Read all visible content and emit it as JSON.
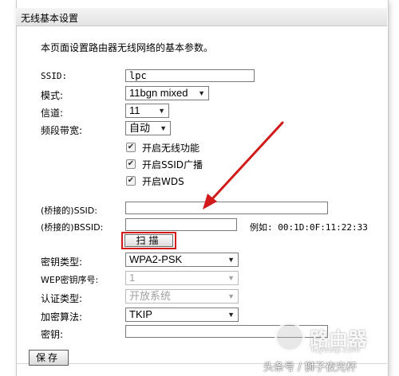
{
  "panel": {
    "title": "无线基本设置",
    "description": "本页面设置路由器无线网络的基本参数。"
  },
  "form": {
    "ssid_label": "SSID:",
    "ssid_value": "lpc",
    "mode_label": "模式:",
    "mode_value": "11bgn mixed",
    "channel_label": "信道:",
    "channel_value": "11",
    "bandwidth_label": "频段带宽:",
    "bandwidth_value": "自动",
    "checkboxes": [
      {
        "label": "开启无线功能",
        "checked": true
      },
      {
        "label": "开启SSID广播",
        "checked": true
      },
      {
        "label": "开启WDS",
        "checked": true
      }
    ],
    "bridge_ssid_label": "(桥接的)SSID:",
    "bridge_ssid_value": "",
    "bridge_bssid_label": "(桥接的)BSSID:",
    "bridge_bssid_value": "",
    "example_label": "例如: 00:1D:0F:11:22:33",
    "scan_label": "扫描",
    "key_type_label": "密钥类型:",
    "key_type_value": "WPA2-PSK",
    "wep_index_label": "WEP密钥序号:",
    "wep_index_value": "1",
    "auth_type_label": "认证类型:",
    "auth_type_value": "开放系统",
    "encryption_label": "加密算法:",
    "encryption_value": "TKIP",
    "key_label": "密钥:",
    "key_value": "",
    "save_label": "保存"
  },
  "annotation": {
    "arrow_color": "#d21a1a",
    "highlight_color": "#d21a1a"
  },
  "watermark": {
    "brand": "路由器",
    "url": "luyouqi.com",
    "caption": "头条号 / 狮子夜光杯"
  }
}
